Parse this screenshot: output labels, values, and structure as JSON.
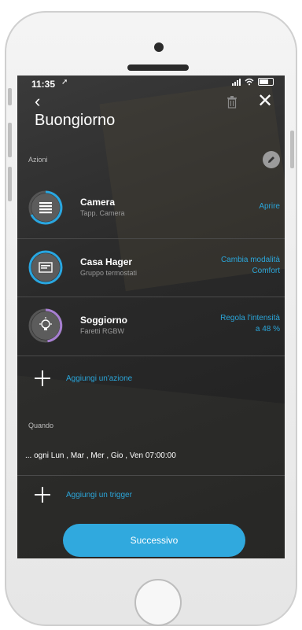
{
  "status_bar": {
    "time": "11:35"
  },
  "header": {
    "back": "‹",
    "title": "Buongiorno",
    "close": "✕"
  },
  "actions_section": {
    "label": "Azioni"
  },
  "actions": [
    {
      "name": "Camera",
      "subtitle": "Tapp. Camera",
      "action": "Aprire",
      "action_line2": ""
    },
    {
      "name": "Casa Hager",
      "subtitle": "Gruppo termostati",
      "action": "Cambia modalità",
      "action_line2": "Comfort"
    },
    {
      "name": "Soggiorno",
      "subtitle": "Faretti RGBW",
      "action": "Regola l'intensità",
      "action_line2": "a 48 %"
    }
  ],
  "add_action": {
    "label": "Aggiungi un'azione"
  },
  "when_section": {
    "label": "Quando",
    "schedule": "... ogni Lun , Mar , Mer , Gio , Ven 07:00:00"
  },
  "add_trigger": {
    "label": "Aggiungi un trigger"
  },
  "next_button": {
    "label": "Successivo"
  },
  "colors": {
    "accent": "#2aa5d9",
    "dial_blue": "#29a6e0",
    "dial_purple": "#a77fd1",
    "button": "#30a9de"
  }
}
